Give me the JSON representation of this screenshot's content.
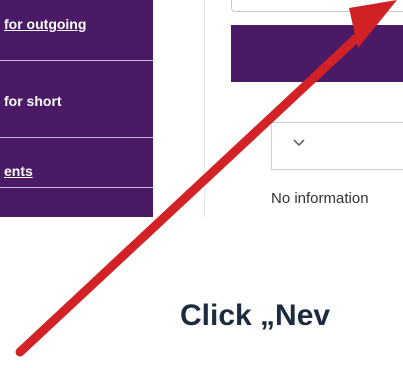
{
  "sidebar": {
    "items": [
      {
        "label": "for outgoing"
      },
      {
        "label": "for short"
      },
      {
        "label": "ents"
      }
    ]
  },
  "panel": {
    "no_info_text": "No information"
  },
  "caption": {
    "text": "Click „Nev"
  },
  "colors": {
    "brand_purple": "#4a1a66",
    "arrow_red": "#d32226",
    "caption_text": "#1d2b3e"
  },
  "icons": {
    "dropdown": "chevron-down-icon",
    "pointer": "arrow-annotation"
  }
}
